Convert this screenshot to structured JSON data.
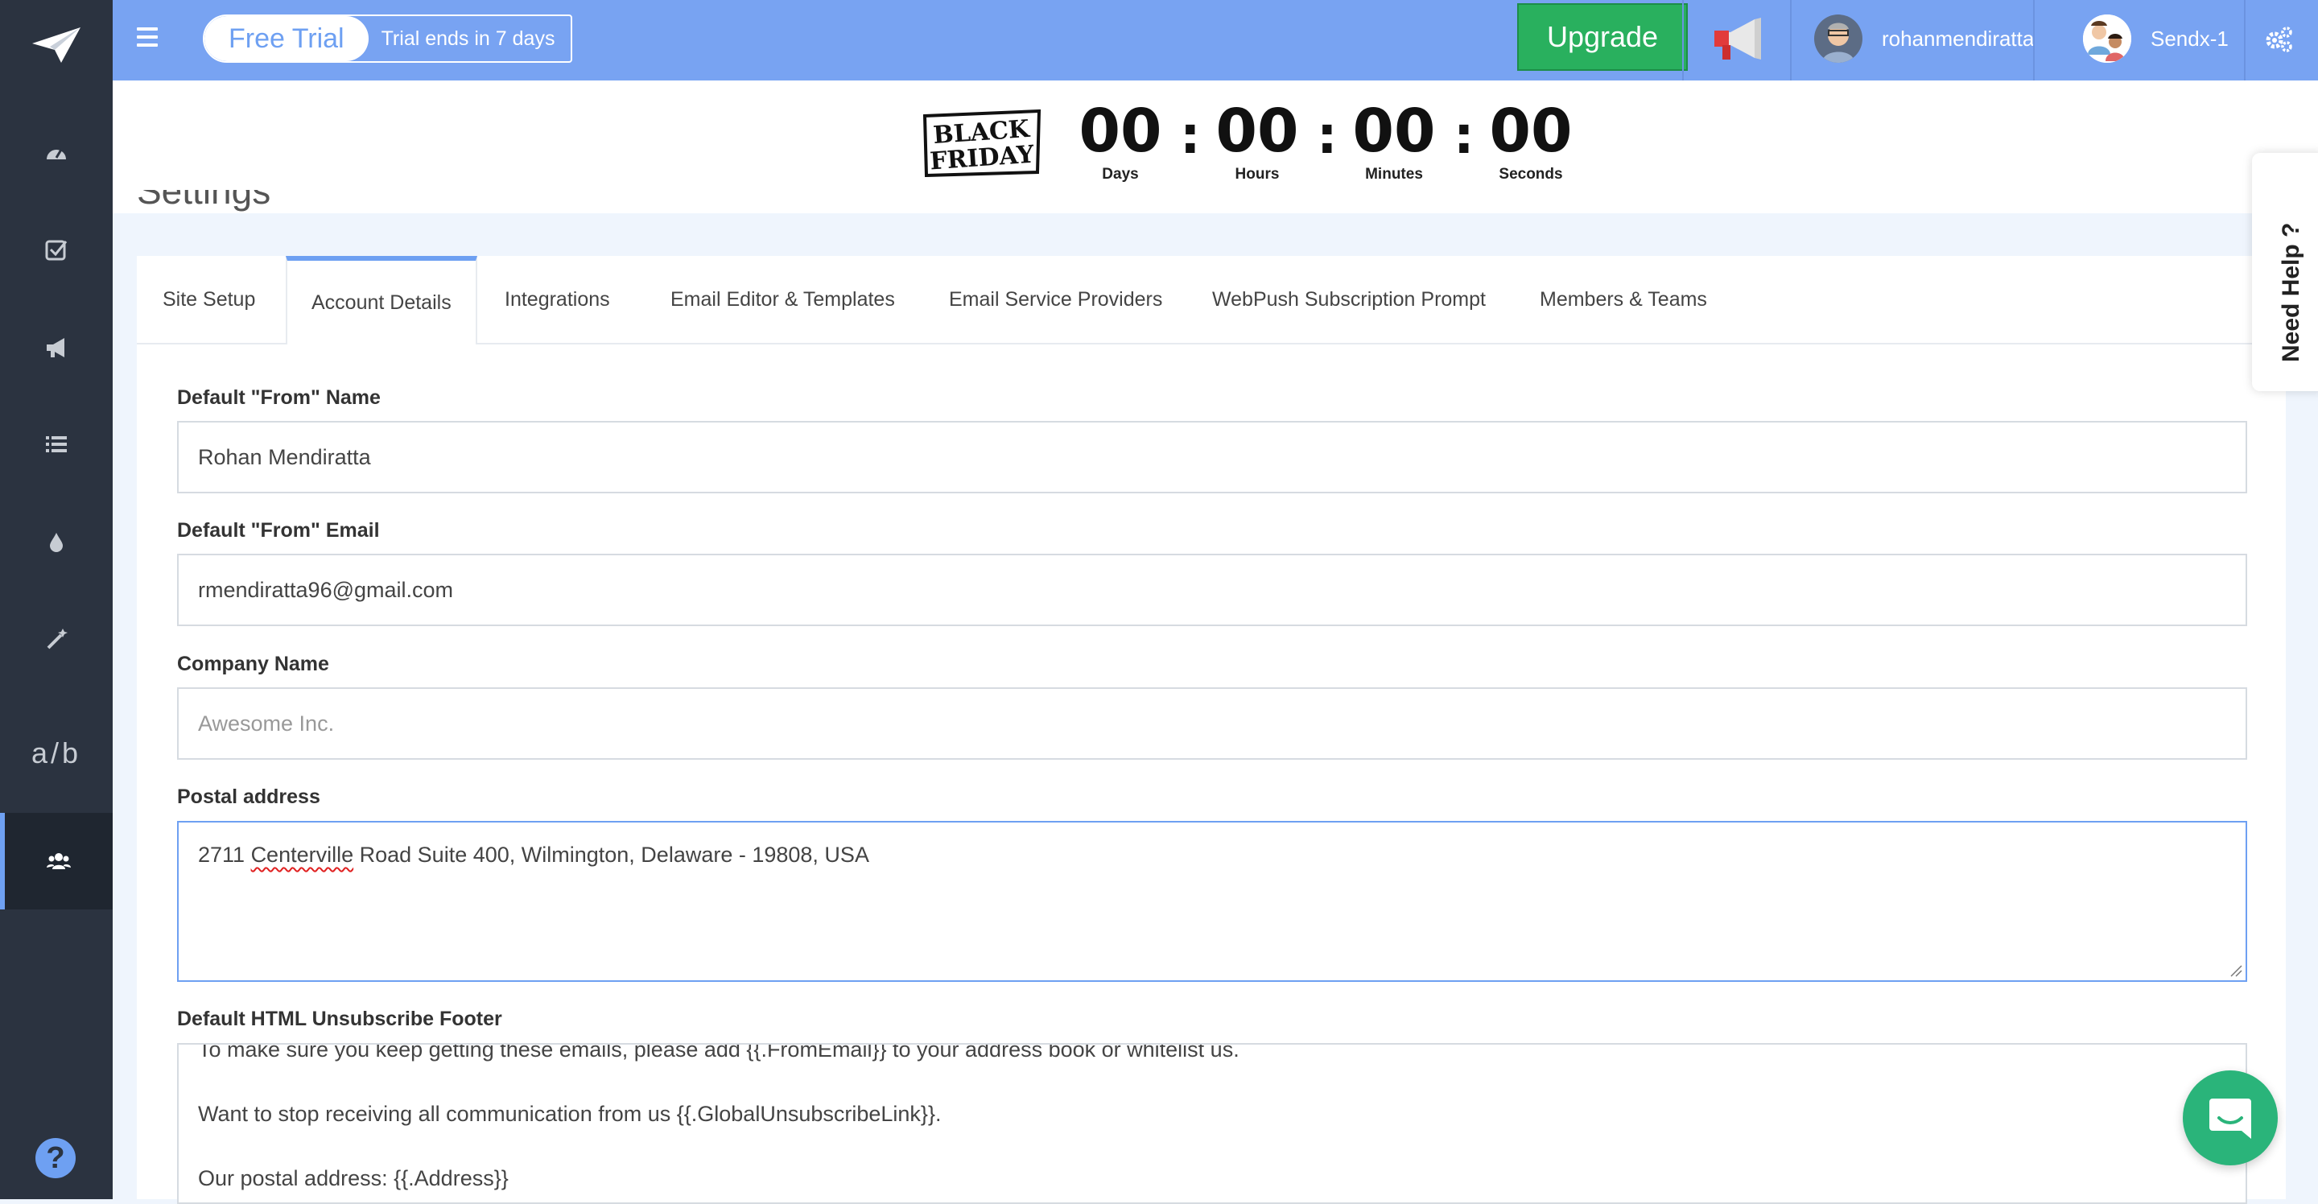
{
  "topbar": {
    "trial_badge": "Free Trial",
    "trial_note": "Trial ends in 7 days",
    "upgrade_label": "Upgrade",
    "username": "rohanmendiratta",
    "workspace": "Sendx-1"
  },
  "banner": {
    "logo_text_1": "BLACK",
    "logo_text_2": "FRIDAY",
    "timer": [
      {
        "value": "00",
        "label": "Days"
      },
      {
        "value": "00",
        "label": "Hours"
      },
      {
        "value": "00",
        "label": "Minutes"
      },
      {
        "value": "00",
        "label": "Seconds"
      }
    ],
    "separator": ":"
  },
  "page": {
    "title": "Settings"
  },
  "tabs": [
    {
      "label": "Site Setup"
    },
    {
      "label": "Account Details"
    },
    {
      "label": "Integrations"
    },
    {
      "label": "Email Editor & Templates"
    },
    {
      "label": "Email Service Providers"
    },
    {
      "label": "WebPush Subscription Prompt"
    },
    {
      "label": "Members & Teams"
    }
  ],
  "form": {
    "from_name_label": "Default \"From\" Name",
    "from_name_value": "Rohan Mendiratta",
    "from_email_label": "Default \"From\" Email",
    "from_email_value": "rmendiratta96@gmail.com",
    "company_label": "Company Name",
    "company_placeholder": "Awesome Inc.",
    "postal_label": "Postal address",
    "postal_prefix": "2711 ",
    "postal_misspelled": "Centerville",
    "postal_suffix": " Road Suite 400, Wilmington, Delaware - 19808, USA",
    "footer_label": "Default HTML Unsubscribe Footer",
    "footer_line1": "To make sure you keep getting these emails, please add {{.FromEmail}} to your address book or whitelist us.",
    "footer_line2": "Want to stop receiving all communication from us {{.GlobalUnsubscribeLink}}.",
    "footer_line3": "Our postal address: {{.Address}}"
  },
  "sidebar": {
    "ab_label": "a/b",
    "help_label": "?"
  },
  "need_help": "Need Help ?"
}
